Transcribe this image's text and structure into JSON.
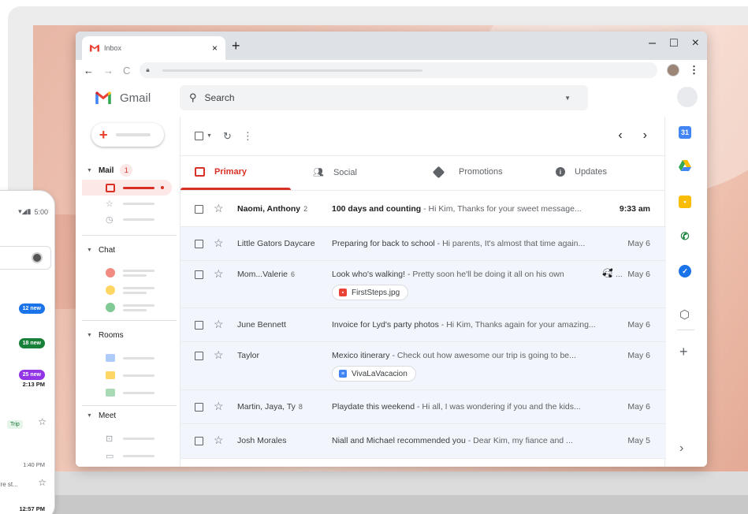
{
  "browser": {
    "tab_title": "Inbox",
    "tab_close": "×",
    "new_tab": "+",
    "minimize": "–",
    "maximize": "□",
    "close": "×"
  },
  "gmail": {
    "logo_text": "Gmail",
    "search_placeholder": "Search"
  },
  "nav": {
    "mail_label": "Mail",
    "mail_count": "1",
    "chat_label": "Chat",
    "rooms_label": "Rooms",
    "meet_label": "Meet"
  },
  "categories": {
    "primary": "Primary",
    "social": "Social",
    "promotions": "Promotions",
    "updates": "Updates"
  },
  "emails": [
    {
      "sender": "Naomi, Anthony",
      "count": "2",
      "subject": "100 days and counting",
      "snippet": " - Hi Kim, Thanks for your sweet message...",
      "date": "9:33 am",
      "unread": true
    },
    {
      "sender": "Little Gators Daycare",
      "count": "",
      "subject": "Preparing for back to school",
      "snippet": " - Hi parents, It's almost that time again...",
      "date": "May 6",
      "unread": false
    },
    {
      "sender": "Mom...Valerie",
      "count": "6",
      "subject": "Look who's walking!",
      "snippet": " - Pretty soon he'll be doing it all on his own",
      "date": "May 6",
      "unread": false,
      "attachment": "FirstSteps.jpg"
    },
    {
      "sender": "June Bennett",
      "count": "",
      "subject": "Invoice for Lyd's party photos",
      "snippet": " - Hi Kim, Thanks again for your amazing...",
      "date": "May 6",
      "unread": false
    },
    {
      "sender": "Taylor",
      "count": "",
      "subject": "Mexico itinerary",
      "snippet": " - Check out how awesome our trip is going to be...",
      "date": "May 6",
      "unread": false,
      "attachment": "VivaLaVacacion"
    },
    {
      "sender": "Martin, Jaya, Ty",
      "count": "8",
      "subject": "Playdate this weekend",
      "snippet": " - Hi all, I was wondering if you and the kids...",
      "date": "May 6",
      "unread": false
    },
    {
      "sender": "Josh Morales",
      "count": "",
      "subject": "Niall and Michael recommended you",
      "snippet": "  - Dear Kim, my fiance and ...",
      "date": "May 5",
      "unread": false
    }
  ],
  "phone": {
    "status_time": "5:00",
    "badge_1": "12 new",
    "badge_2": "18 new",
    "badge_3": "25 new",
    "time_1": "2:13 PM",
    "chip_trip": "Trip",
    "time_2": "1:40 PM",
    "snippet_2": "'re st...",
    "time_3": "12:57 PM"
  },
  "colors": {
    "gmail_red": "#d93025",
    "badge_blue": "#1a73e8",
    "badge_green": "#188038",
    "badge_purple": "#9334e6"
  },
  "icons": {
    "search": "search-icon",
    "refresh": "refresh-icon",
    "more": "more-vert-icon",
    "star": "star-icon"
  }
}
